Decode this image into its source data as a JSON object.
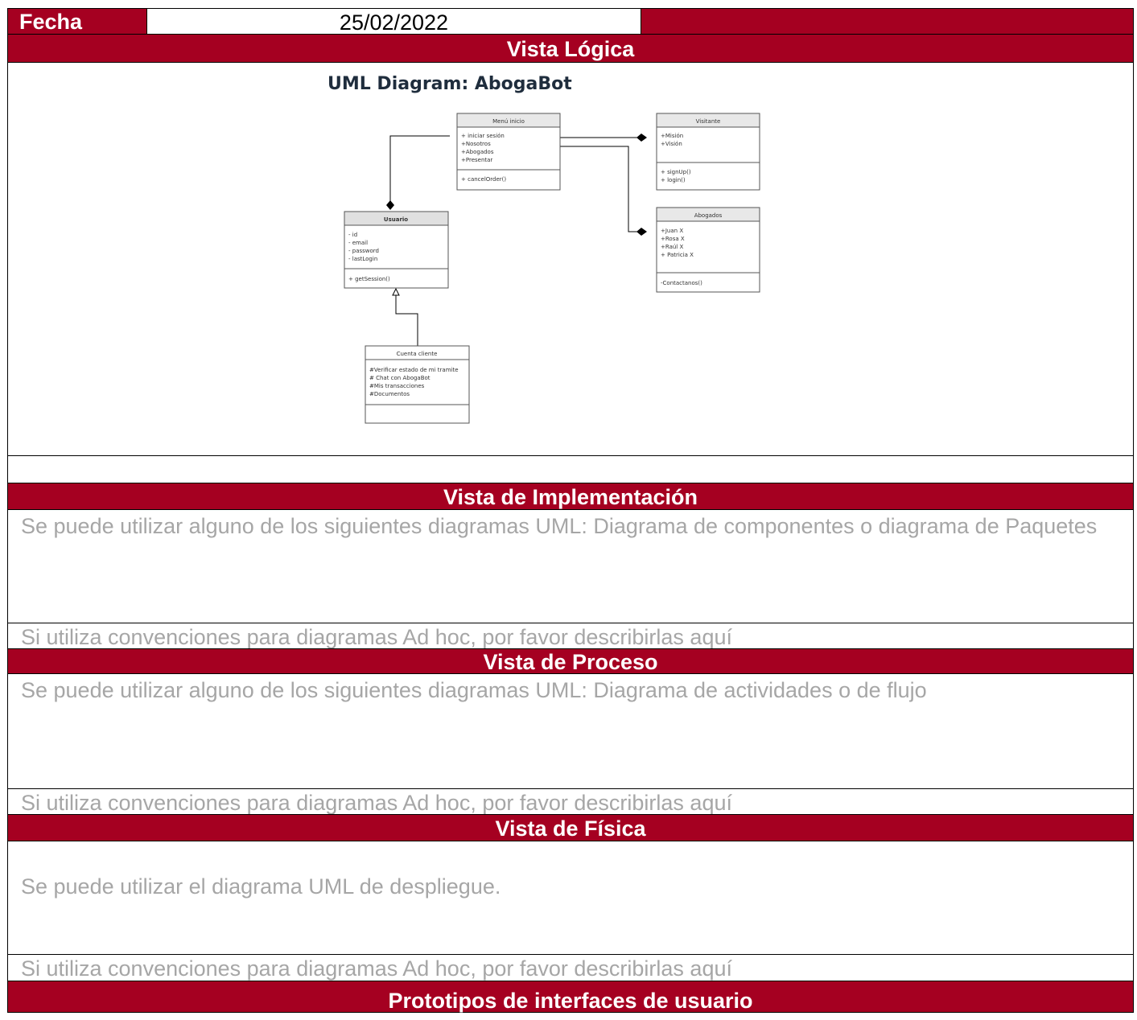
{
  "header": {
    "fecha_label": "Fecha",
    "fecha_value": "25/02/2022"
  },
  "sections": {
    "logica_title": "Vista Lógica",
    "implementacion_title": "Vista de Implementación",
    "implementacion_hint": "Se puede utilizar alguno de los siguientes diagramas UML: Diagrama de componentes o diagrama de Paquetes",
    "implementacion_adhoc": "Si utiliza convenciones para diagramas Ad hoc, por favor describirlas aquí",
    "proceso_title": "Vista de Proceso",
    "proceso_hint": "Se puede utilizar alguno de los siguientes diagramas UML: Diagrama de actividades o de flujo",
    "proceso_adhoc": "Si utiliza convenciones para diagramas Ad hoc, por favor describirlas aquí",
    "fisica_title": "Vista de Física",
    "fisica_hint": "Se puede utilizar el diagrama UML de despliegue.",
    "fisica_adhoc": "Si utiliza convenciones para diagramas Ad hoc, por favor describirlas aquí",
    "prototipos_title": "Prototipos de interfaces de usuario"
  },
  "uml": {
    "title": "UML Diagram: AbogaBot",
    "menu": {
      "name": "Menú inicio",
      "attrs": [
        "+ iniciar sesión",
        "+Nosotros",
        "+Abogados",
        "+Presentar"
      ],
      "ops": [
        "+ cancelOrder()"
      ]
    },
    "visitante": {
      "name": "Visitante",
      "attrs": [
        "+Misión",
        "+Visión"
      ],
      "ops": [
        "+ signUp()",
        "+ login()"
      ]
    },
    "usuario": {
      "name": "Usuario",
      "attrs": [
        "- id",
        "- email",
        "- password",
        "- lastLogin"
      ],
      "ops": [
        "+ getSession()"
      ]
    },
    "abogados": {
      "name": "Abogados",
      "attrs": [
        "+Juan X",
        "+Rosa X",
        "+Raúl X",
        "+ Patricia X"
      ],
      "ops": [
        "-Contactanos()"
      ]
    },
    "cuenta": {
      "name": "Cuenta  cliente",
      "attrs": [
        "#Verificar estado de mi tramite",
        "# Chat con AbogaBot",
        "#Mis transacciones",
        "#Documentos"
      ],
      "ops": []
    }
  },
  "colors": {
    "bar": "#a50021",
    "hint": "#a6a6a6"
  }
}
